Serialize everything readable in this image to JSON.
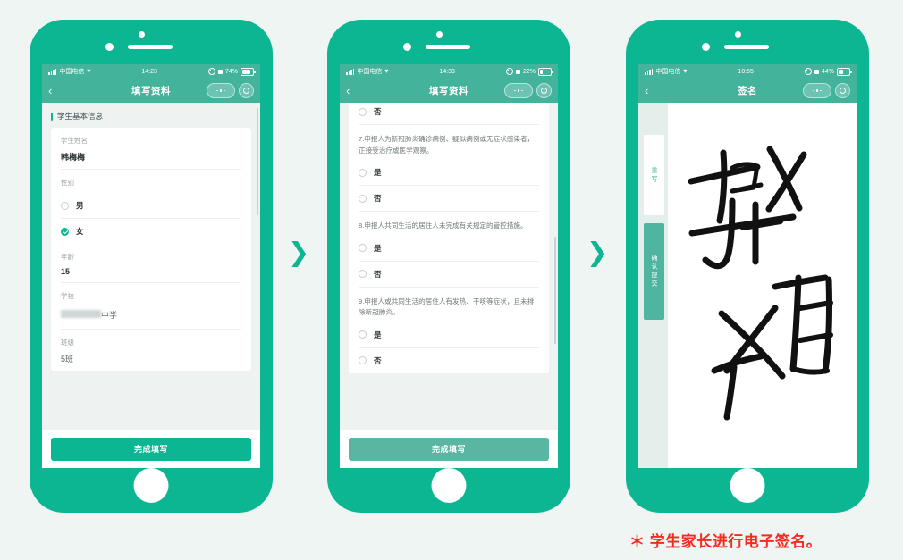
{
  "caption": "＊ 学生家长进行电子签名。",
  "arrow_glyph": "❯",
  "phones": [
    {
      "id": "form-basic-info",
      "status": {
        "carrier": "中国电信",
        "time": "14:23",
        "battery_text": "74%",
        "battery_level": 74
      },
      "nav": {
        "back": "‹",
        "title": "填写资料"
      },
      "section_title": "学生基本信息",
      "fields": [
        {
          "type": "text",
          "label": "学生姓名",
          "value": "韩梅梅"
        },
        {
          "type": "radio",
          "label": "性别",
          "options": [
            {
              "label": "男",
              "checked": false
            },
            {
              "label": "女",
              "checked": true
            }
          ]
        },
        {
          "type": "text",
          "label": "年龄",
          "value": "15"
        },
        {
          "type": "redacted",
          "label": "学校",
          "redacted": "深圳市南山",
          "value": "中学"
        },
        {
          "type": "text",
          "label": "班级",
          "value": "5班"
        }
      ],
      "footer_button": {
        "label": "完成填写",
        "state": "enabled"
      }
    },
    {
      "id": "form-health-questions",
      "status": {
        "carrier": "中国电信",
        "time": "14:33",
        "battery_text": "22%",
        "battery_level": 22
      },
      "nav": {
        "back": "‹",
        "title": "填写资料"
      },
      "partial_top_option": "否",
      "questions": [
        {
          "number": "7.",
          "text": "7.申报人为新冠肺炎确诊病例、疑似病例或无症状感染者，正接受治疗或医学观察。",
          "options": [
            {
              "label": "是",
              "checked": false
            },
            {
              "label": "否",
              "checked": false
            }
          ]
        },
        {
          "number": "8.",
          "text": "8.申报人共同生活的居住人未完成有关规定的管控措施。",
          "options": [
            {
              "label": "是",
              "checked": false
            },
            {
              "label": "否",
              "checked": false
            }
          ]
        },
        {
          "number": "9.",
          "text": "9.申报人或共同生活的居住人有发热、干咳等症状，且未排除新冠肺炎。",
          "options": [
            {
              "label": "是",
              "checked": false
            },
            {
              "label": "否",
              "checked": false
            }
          ]
        }
      ],
      "footer_button": {
        "label": "完成填写",
        "state": "disabled"
      }
    },
    {
      "id": "signature-pad",
      "status": {
        "carrier": "中国电信",
        "time": "10:55",
        "battery_text": "44%",
        "battery_level": 44
      },
      "nav": {
        "back": "‹",
        "title": "签名"
      },
      "side_buttons": [
        {
          "label": "重写",
          "style": "light"
        },
        {
          "label": "确认提交",
          "style": "solid"
        }
      ]
    }
  ],
  "colors": {
    "frame": "#0cb692",
    "accent": "#0cb692",
    "navbar": "#43b39b",
    "page_bg": "#eef5f3",
    "caption_red": "#f22c20",
    "disabled_button": "#5bb5a3"
  }
}
